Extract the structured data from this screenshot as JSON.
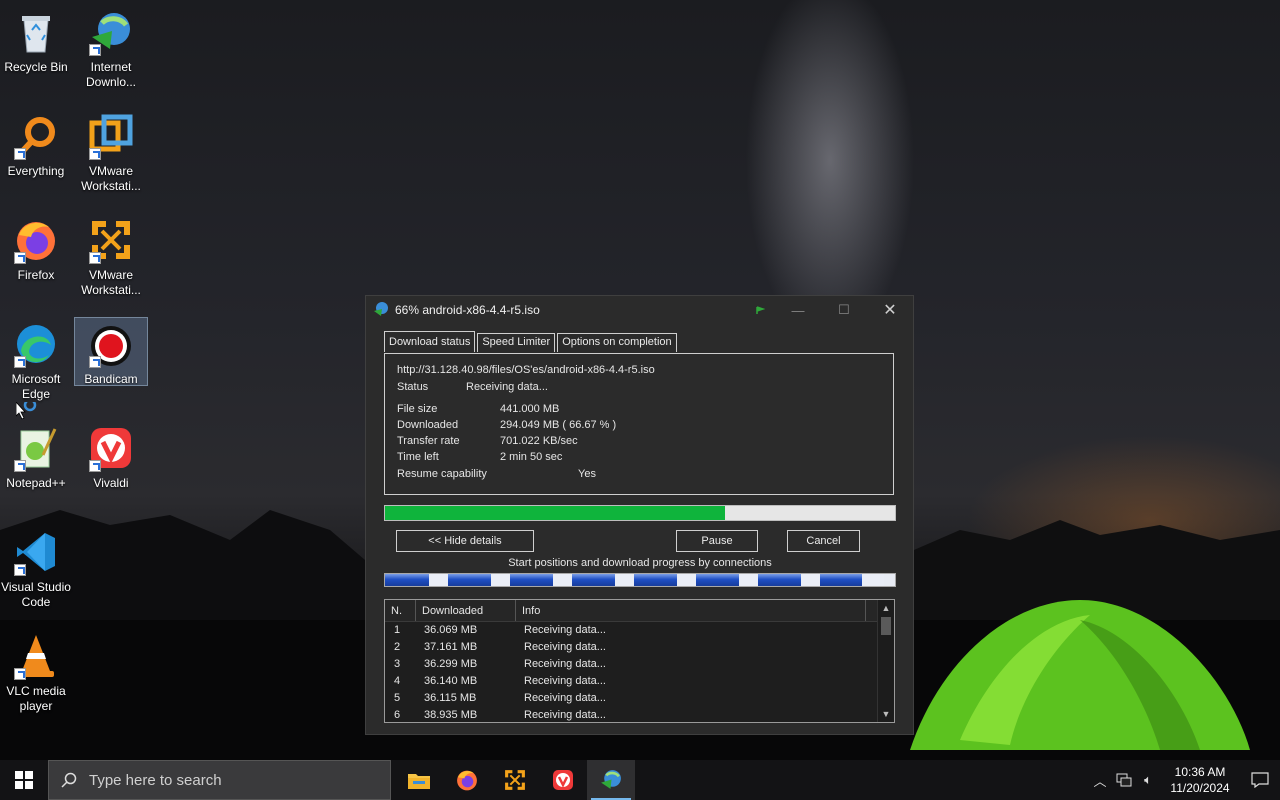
{
  "desktop": {
    "icons": [
      {
        "label": "Recycle Bin",
        "icon": "recycle-bin-icon"
      },
      {
        "label": "Internet Downlo...",
        "icon": "idm-icon"
      },
      {
        "label": "Everything",
        "icon": "everything-icon"
      },
      {
        "label": "VMware Workstati...",
        "icon": "vmware-icon"
      },
      {
        "label": "Firefox",
        "icon": "firefox-icon"
      },
      {
        "label": "VMware Workstati...",
        "icon": "vmware-player-icon"
      },
      {
        "label": "Microsoft Edge",
        "icon": "edge-icon"
      },
      {
        "label": "Bandicam",
        "icon": "bandicam-icon"
      },
      {
        "label": "Notepad++",
        "icon": "notepadpp-icon"
      },
      {
        "label": "Vivaldi",
        "icon": "vivaldi-icon"
      },
      {
        "label": "Visual Studio Code",
        "icon": "vscode-icon"
      },
      {
        "label": "VLC media player",
        "icon": "vlc-icon"
      }
    ]
  },
  "idm": {
    "title": "66% android-x86-4.4-r5.iso",
    "tabs": [
      "Download status",
      "Speed Limiter",
      "Options on completion"
    ],
    "url": "http://31.128.40.98/files/OS'es/android-x86-4.4-r5.iso",
    "status_label": "Status",
    "status_value": "Receiving data...",
    "fields": [
      {
        "label": "File size",
        "value": "441.000  MB"
      },
      {
        "label": "Downloaded",
        "value": "294.049  MB  ( 66.67 % )"
      },
      {
        "label": "Transfer rate",
        "value": "701.022  KB/sec"
      },
      {
        "label": "Time left",
        "value": "2 min 50 sec"
      }
    ],
    "resume_label": "Resume capability",
    "resume_value": "Yes",
    "progress_percent": 66.67,
    "buttons": {
      "hide_details": "<< Hide details",
      "pause": "Pause",
      "cancel": "Cancel"
    },
    "connections_label": "Start positions and download progress by connections",
    "table": {
      "headers": [
        "N.",
        "Downloaded",
        "Info"
      ],
      "rows": [
        {
          "n": "1",
          "downloaded": "36.069  MB",
          "info": "Receiving data..."
        },
        {
          "n": "2",
          "downloaded": "37.161  MB",
          "info": "Receiving data..."
        },
        {
          "n": "3",
          "downloaded": "36.299  MB",
          "info": "Receiving data..."
        },
        {
          "n": "4",
          "downloaded": "36.140  MB",
          "info": "Receiving data..."
        },
        {
          "n": "5",
          "downloaded": "36.115  MB",
          "info": "Receiving data..."
        },
        {
          "n": "6",
          "downloaded": "38.935  MB",
          "info": "Receiving data..."
        }
      ]
    }
  },
  "taskbar": {
    "search_placeholder": "Type here to search",
    "apps": [
      "file-explorer-icon",
      "firefox-icon",
      "vmware-icon",
      "vivaldi-icon",
      "idm-icon"
    ],
    "time": "10:36 AM",
    "date": "11/20/2024"
  }
}
